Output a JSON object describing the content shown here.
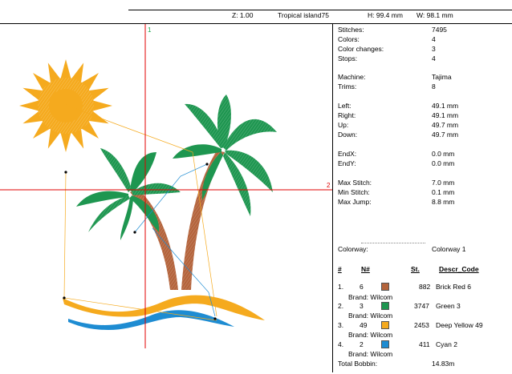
{
  "header": {
    "zoom": "Z: 1.00",
    "design_name": "Tropical island75",
    "height": "H: 99.4 mm",
    "width": "W: 98.1 mm"
  },
  "canvas": {
    "start_marker": "1",
    "end_marker": "2",
    "colors": {
      "sun": "#F5AA1E",
      "palm": "#1E9650",
      "trunk": "#B4643C",
      "sand": "#F5AA1E",
      "water": "#1E8CD2",
      "crosshair": "#E00000",
      "marker": "#17A84A"
    }
  },
  "stats": [
    {
      "label": "Stitches:",
      "value": "7495"
    },
    {
      "label": "Colors:",
      "value": "4"
    },
    {
      "label": "Color changes:",
      "value": "3"
    },
    {
      "label": "Stops:",
      "value": "4"
    },
    {
      "label": "Machine:",
      "value": "Tajima"
    },
    {
      "label": "Trims:",
      "value": "8"
    },
    {
      "label": "Left:",
      "value": "49.1 mm"
    },
    {
      "label": "Right:",
      "value": "49.1 mm"
    },
    {
      "label": "Up:",
      "value": "49.7 mm"
    },
    {
      "label": "Down:",
      "value": "49.7 mm"
    },
    {
      "label": "EndX:",
      "value": "0.0 mm"
    },
    {
      "label": "EndY:",
      "value": "0.0 mm"
    },
    {
      "label": "Max Stitch:",
      "value": "7.0 mm"
    },
    {
      "label": "Min Stitch:",
      "value": "0.1 mm"
    },
    {
      "label": "Max Jump:",
      "value": "8.8 mm"
    }
  ],
  "colorway": {
    "label": "Colorway:",
    "value": "Colorway 1"
  },
  "table": {
    "headers": {
      "num": "#",
      "needle": "N#",
      "stitches": "St.",
      "descr": "Descr_Code"
    },
    "rows": [
      {
        "index": "1.",
        "needle": "6",
        "color": "#B4643C",
        "stitches": "882",
        "descr": "Brick Red 6",
        "brand": "Brand: Wilcom"
      },
      {
        "index": "2.",
        "needle": "3",
        "color": "#1E9650",
        "stitches": "3747",
        "descr": "Green 3",
        "brand": "Brand: Wilcom"
      },
      {
        "index": "3.",
        "needle": "49",
        "color": "#F5AA1E",
        "stitches": "2453",
        "descr": "Deep Yellow 49",
        "brand": "Brand: Wilcom"
      },
      {
        "index": "4.",
        "needle": "2",
        "color": "#1E8CD2",
        "stitches": "411",
        "descr": "Cyan 2",
        "brand": "Brand: Wilcom"
      }
    ],
    "total_label": "Total Bobbin:",
    "total_value": "14.83m"
  }
}
